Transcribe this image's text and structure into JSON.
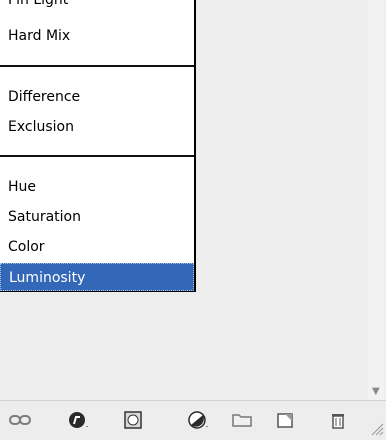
{
  "menu": {
    "items": [
      "Pin Light",
      "Hard Mix",
      "Difference",
      "Exclusion",
      "Hue",
      "Saturation",
      "Color",
      "Luminosity"
    ],
    "selected": "Luminosity"
  },
  "toolbar": {
    "icons": [
      "link-layers-icon",
      "fx-icon",
      "mask-icon",
      "adjustment-icon",
      "group-folder-icon",
      "new-layer-icon",
      "trash-icon"
    ]
  },
  "colors": {
    "selected_bg": "#3367b8",
    "panel_bg": "#ededed"
  }
}
